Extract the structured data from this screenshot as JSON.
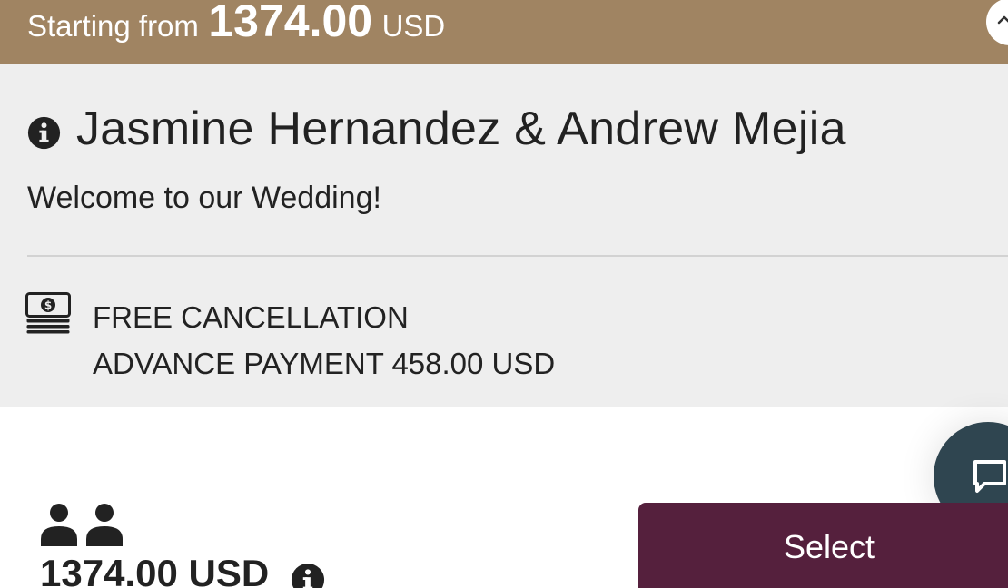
{
  "banner": {
    "prefix": "Starting from",
    "amount": "1374.00",
    "currency": "USD"
  },
  "listing": {
    "title": "Jasmine Hernandez & Andrew Mejia",
    "welcome": "Welcome to our Wedding!"
  },
  "policy": {
    "cancellation": "FREE CANCELLATION",
    "advance_payment": "ADVANCE PAYMENT 458.00 USD"
  },
  "room": {
    "price": "1374.00 USD",
    "guests_icon": "two-persons-icon"
  },
  "actions": {
    "select_label": "Select"
  },
  "colors": {
    "banner": "#a08462",
    "panel": "#eeeeee",
    "select_button": "#55203d",
    "chat_button": "#2f4550"
  },
  "icons": [
    "chevron-up-icon",
    "info-icon",
    "money-stack-icon",
    "two-persons-icon",
    "chat-icon"
  ]
}
